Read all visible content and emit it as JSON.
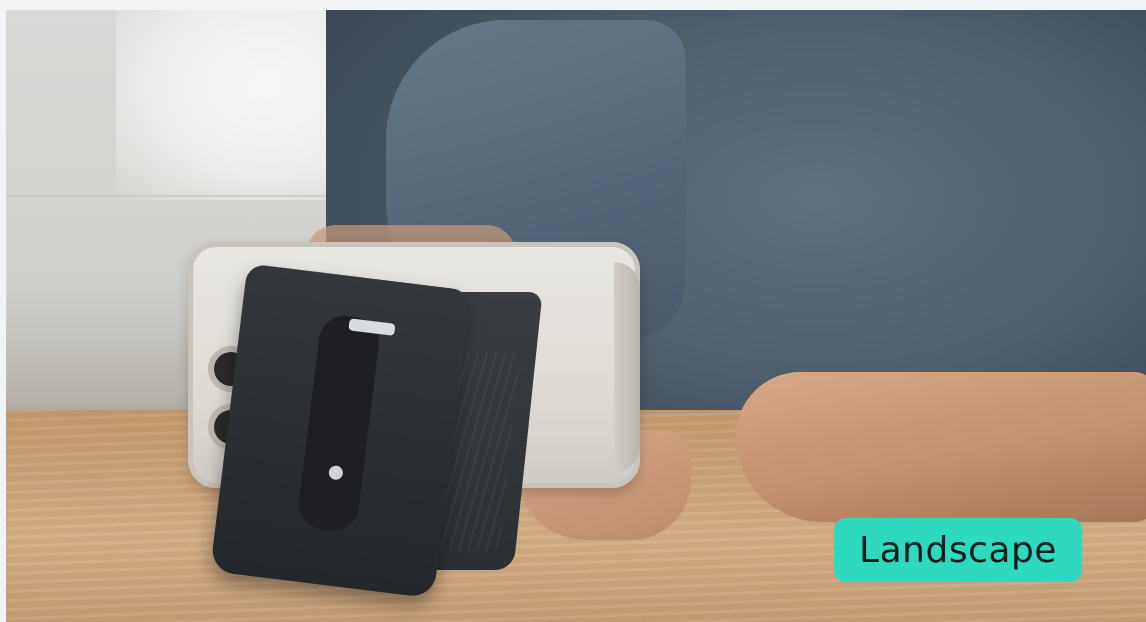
{
  "badge": {
    "label": "Landscape"
  },
  "colors": {
    "badge_bg": "#2fd9bf",
    "badge_text": "#0f1d1c",
    "page_bg": "#f2f3f5"
  },
  "photo": {
    "content": "product-photo"
  }
}
